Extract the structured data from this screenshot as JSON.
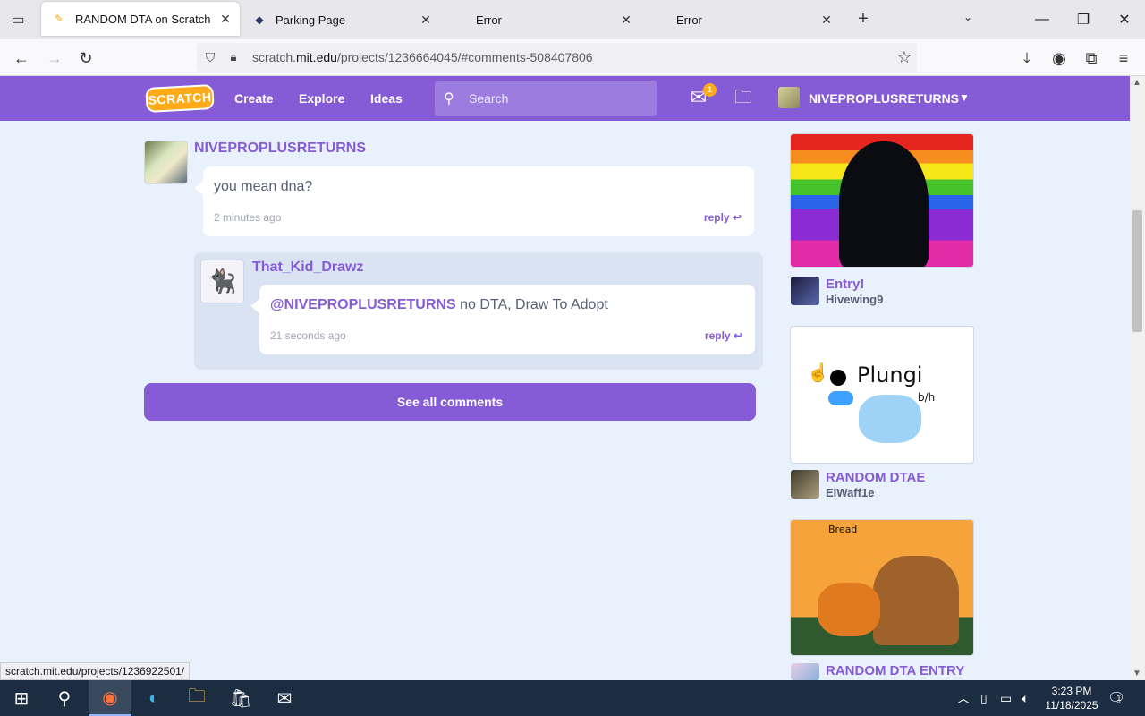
{
  "browser": {
    "tabs": [
      {
        "title": "RANDOM DTA on Scratch",
        "icon": "scratch-favicon",
        "active": true
      },
      {
        "title": "Parking Page",
        "icon": "diamond-favicon",
        "active": false
      },
      {
        "title": "Error",
        "icon": "",
        "active": false
      },
      {
        "title": "Error",
        "icon": "",
        "active": false
      }
    ],
    "url_prefix": "scratch.",
    "url_domain": "mit.edu",
    "url_path": "/projects/1236664045/#comments-508407806",
    "status_url": "scratch.mit.edu/projects/1236922501/"
  },
  "header": {
    "logo": "SCRATCH",
    "nav": [
      "Create",
      "Explore",
      "Ideas"
    ],
    "search_placeholder": "Search",
    "message_count": "1",
    "username": "NIVEPROPLUSRETURNS"
  },
  "comments": [
    {
      "user": "NIVEPROPLUSRETURNS",
      "text": "you mean dna?",
      "time": "2 minutes ago",
      "reply_label": "reply"
    },
    {
      "user": "That_Kid_Drawz",
      "mention": "@NIVEPROPLUSRETURNS",
      "text": " no DTA, Draw To Adopt",
      "time": "21 seconds ago",
      "reply_label": "reply"
    }
  ],
  "see_all_label": "See all comments",
  "sidebar_projects": [
    {
      "title": "Entry!",
      "author": "Hivewing9"
    },
    {
      "title": "RANDOM DTAE",
      "author": "ElWaff1e",
      "thumb_text": "Plungi",
      "thumb_subtext": "b/h"
    },
    {
      "title": "RANDOM DTA ENTRY",
      "thumb_text": "Bread"
    }
  ],
  "taskbar": {
    "time": "3:23 PM",
    "date": "11/18/2025",
    "notification_count": "1"
  },
  "colors": {
    "scratch_purple": "#855cd6",
    "page_bg": "#e9f1fc",
    "reply_thread_bg": "#d9e3f2",
    "taskbar_bg": "#1c2d42"
  }
}
